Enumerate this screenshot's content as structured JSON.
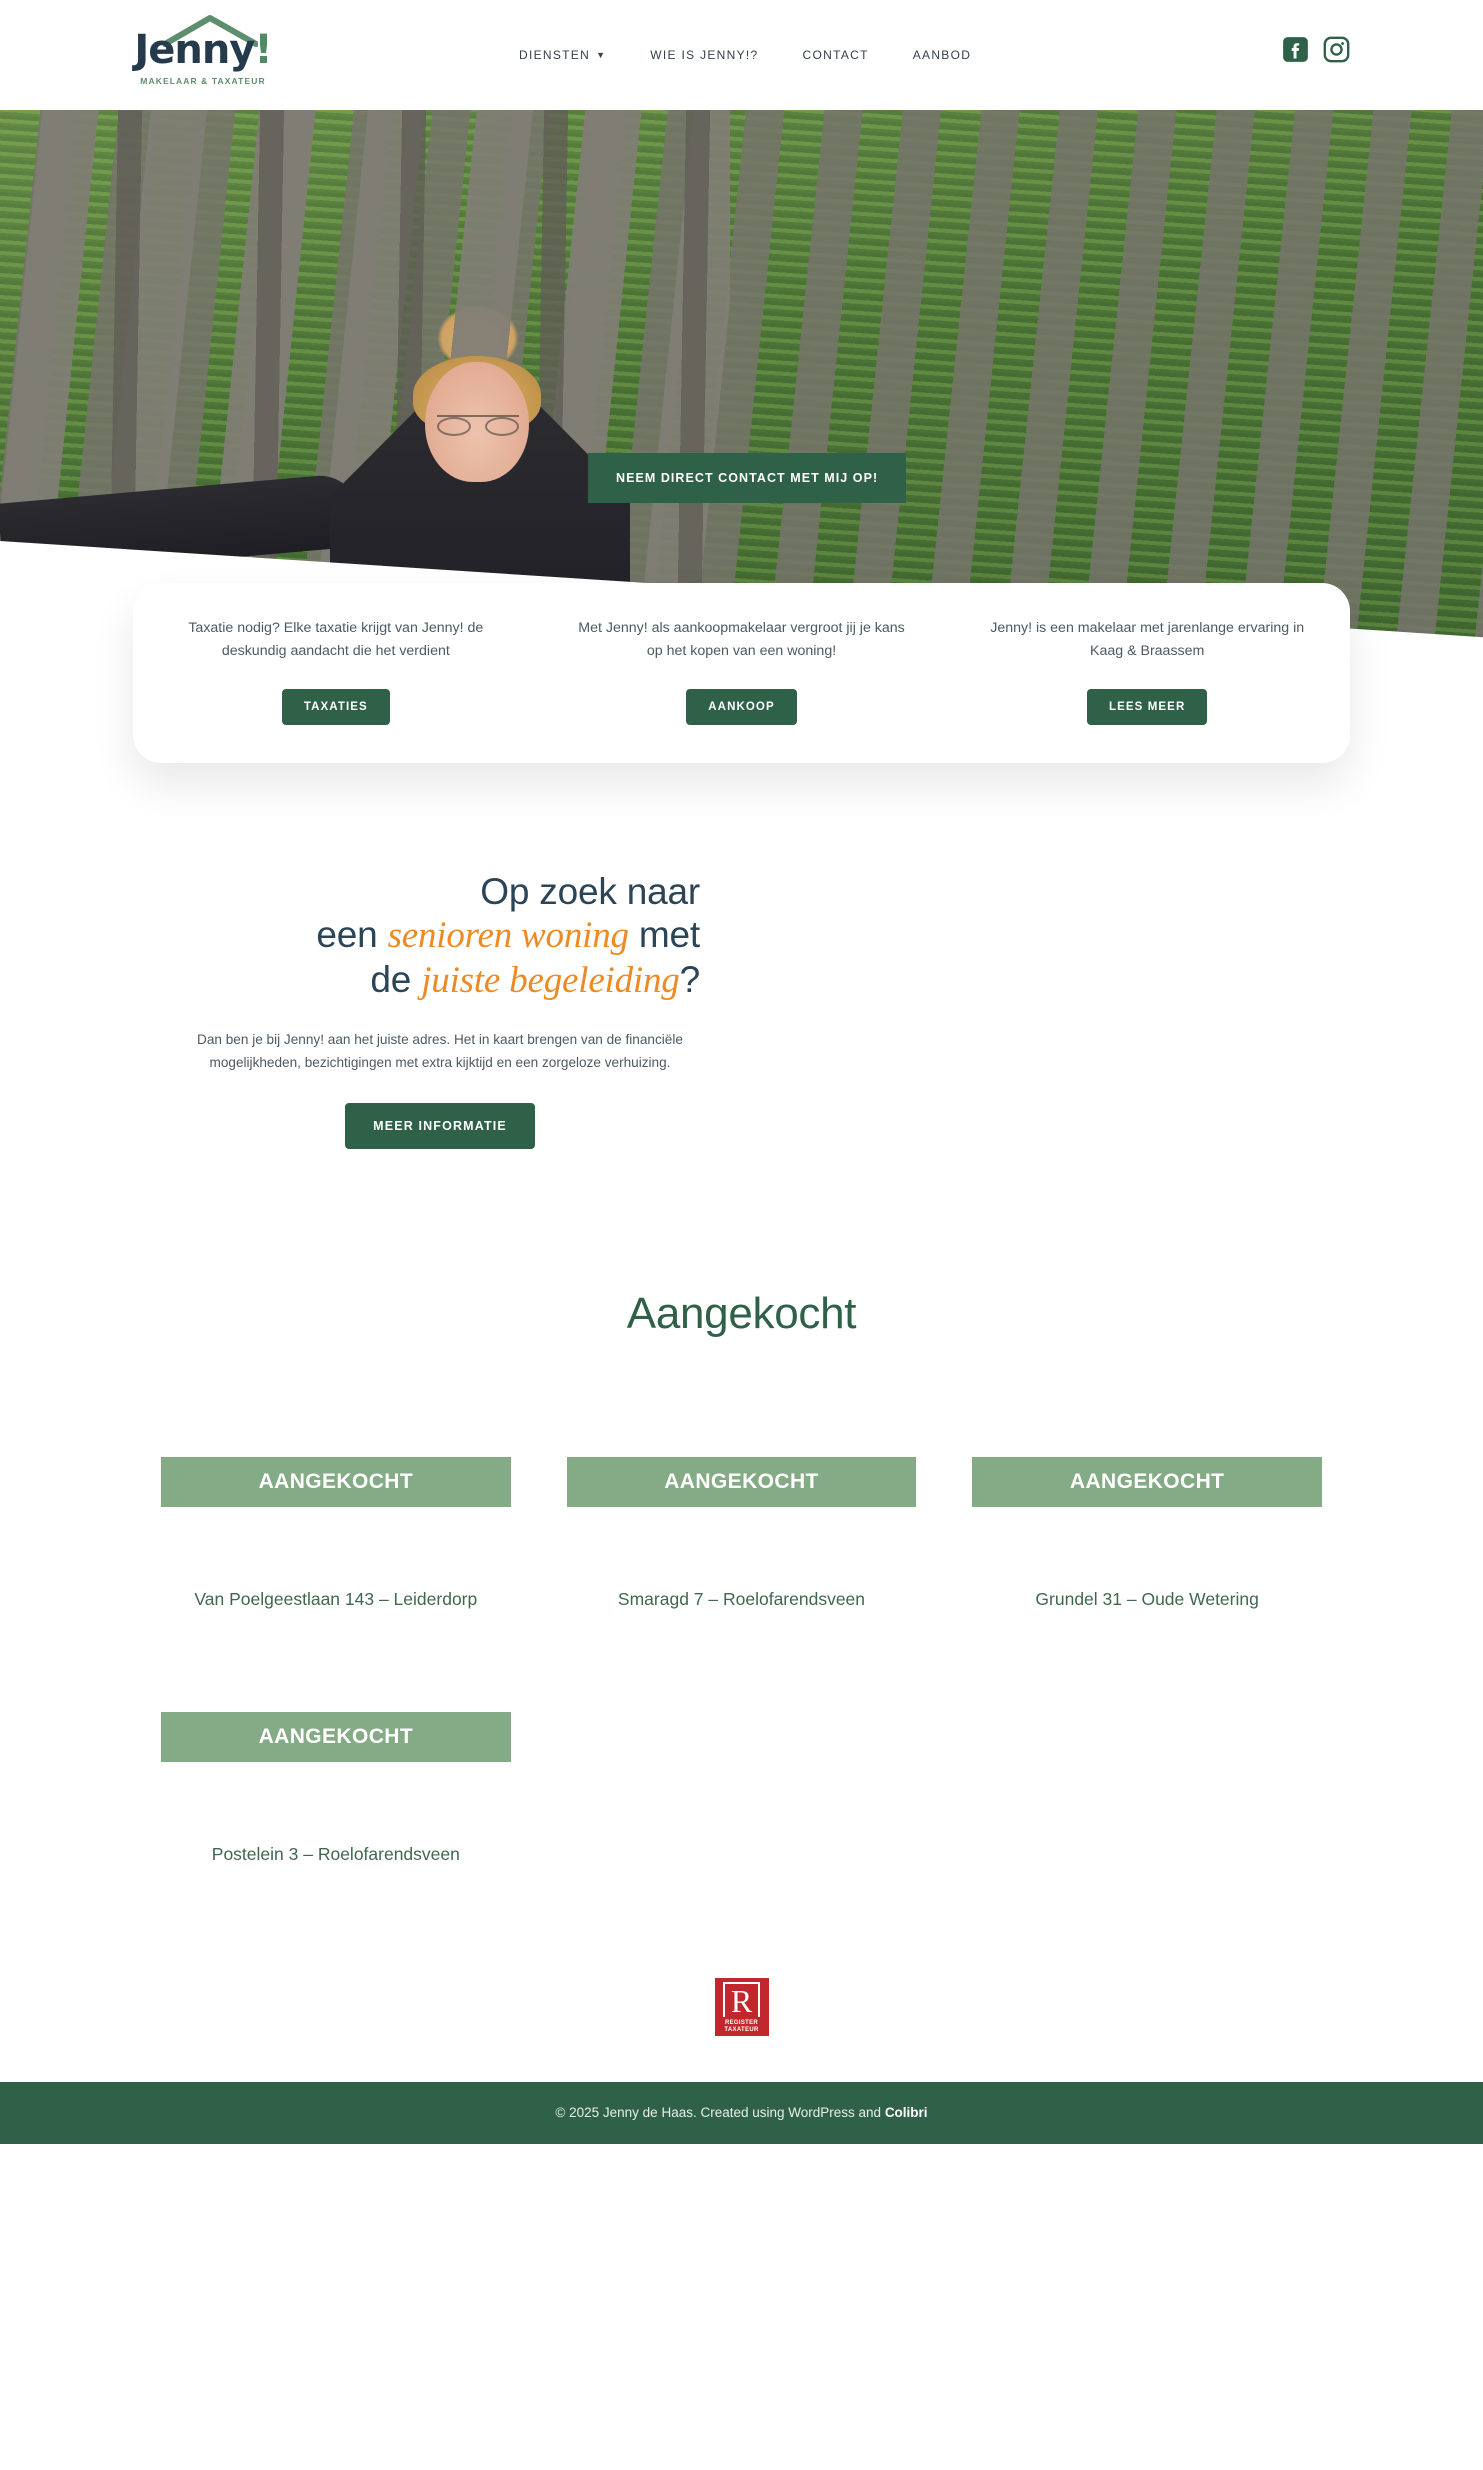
{
  "header": {
    "logo": {
      "word": "Jenny",
      "excl": "!",
      "subtitle": "MAKELAAR & TAXATEUR"
    },
    "nav": [
      {
        "label": "DIENSTEN",
        "has_caret": true,
        "icon": "chevron-down-icon"
      },
      {
        "label": "WIE IS JENNY!?",
        "has_caret": false
      },
      {
        "label": "CONTACT",
        "has_caret": false
      },
      {
        "label": "AANBOD",
        "has_caret": false
      }
    ],
    "social": [
      {
        "icon": "facebook-icon",
        "label": "Facebook"
      },
      {
        "icon": "instagram-icon",
        "label": "Instagram"
      }
    ]
  },
  "hero": {
    "cta_label": "NEEM DIRECT CONTACT MET MIJ OP!"
  },
  "cards": [
    {
      "text": "Taxatie nodig? Elke taxatie krijgt van Jenny! de deskundig aandacht die het verdient",
      "button": "TAXATIES"
    },
    {
      "text": "Met Jenny! als aankoopmakelaar vergroot jij je kans op het kopen van een woning!",
      "button": "AANKOOP"
    },
    {
      "text": "Jenny! is een makelaar met jarenlange ervaring in Kaag & Braassem",
      "button": "LEES MEER"
    }
  ],
  "senior": {
    "line1": "Op zoek naar",
    "line2_pre": "een ",
    "line2_em": "senioren woning",
    "line2_post": " met",
    "line3_pre": "de ",
    "line3_em": "juiste begeleiding",
    "line3_post": "?",
    "paragraph": "Dan ben je bij Jenny! aan het juiste adres. Het in kaart brengen van de financiële mogelijkheden, bezichtigingen met extra kijktijd en een zorgeloze verhuizing.",
    "button": "MEER INFORMATIE"
  },
  "listings_section": {
    "title": "Aangekocht",
    "items": [
      {
        "badge": "AANGEKOCHT",
        "title": "Van Poelgeestlaan 143 – Leiderdorp"
      },
      {
        "badge": "AANGEKOCHT",
        "title": "Smaragd 7 – Roelofarendsveen"
      },
      {
        "badge": "AANGEKOCHT",
        "title": "Grundel 31 – Oude Wetering"
      },
      {
        "badge": "AANGEKOCHT",
        "title": "Postelein 3 – Roelofarendsveen"
      }
    ]
  },
  "register_logo": {
    "letter": "R",
    "line1": "REGISTER",
    "line2": "TAXATEUR"
  },
  "footer": {
    "text": "© 2025 Jenny de Haas. Created using WordPress and ",
    "brand": "Colibri"
  },
  "colors": {
    "brand_green": "#2f6149",
    "badge_green": "#84ab85",
    "accent_orange": "#ee8a23",
    "heading_navy": "#2b4456",
    "register_red": "#c1272d"
  }
}
